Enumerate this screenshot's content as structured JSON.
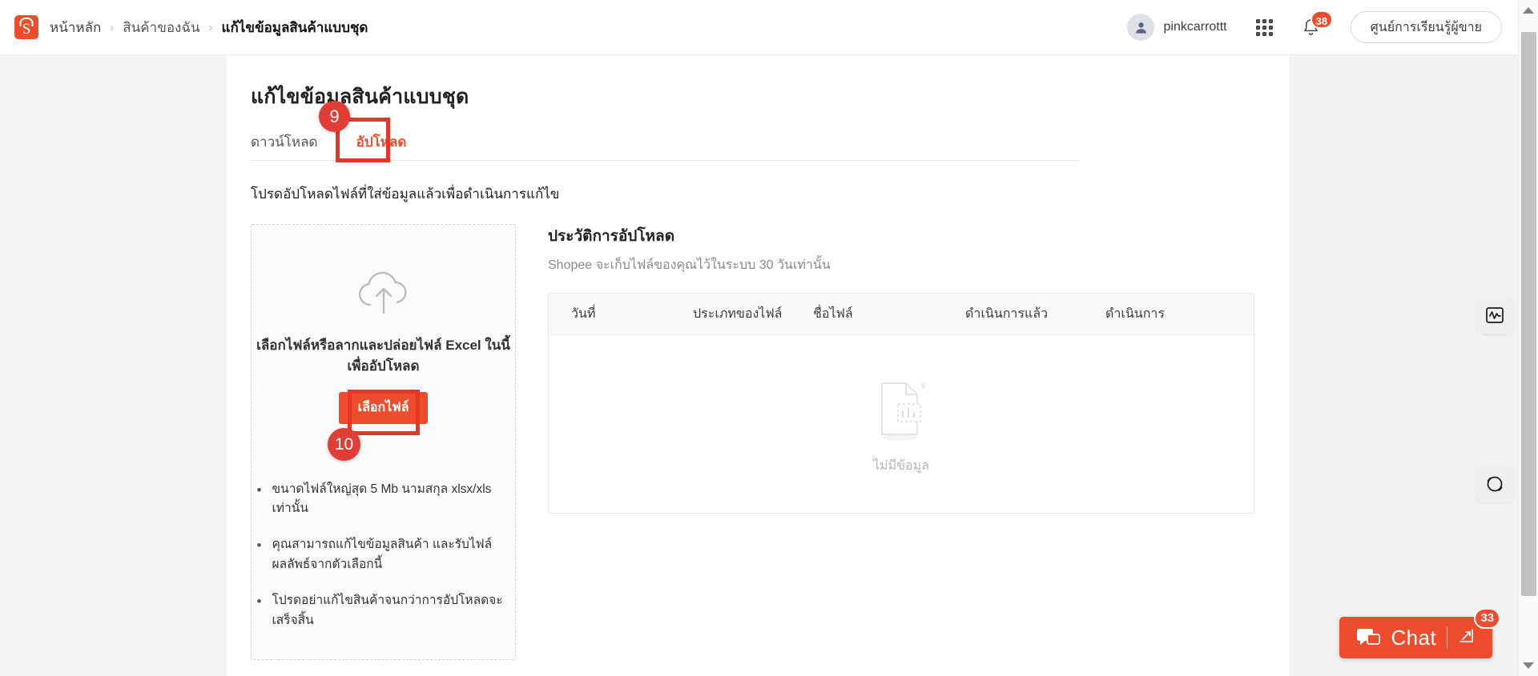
{
  "header": {
    "logo_alt": "shopee-logo",
    "breadcrumb": [
      {
        "label": "หน้าหลัก",
        "current": false
      },
      {
        "label": "สินค้าของฉัน",
        "current": false
      },
      {
        "label": "แก้ไขข้อมูลสินค้าแบบชุด",
        "current": true
      }
    ],
    "separator": "›",
    "user_name": "pinkcarrottt",
    "apps_icon": "grid-apps-icon",
    "notification_icon": "bell-icon",
    "notification_count": "38",
    "learning_center_label": "ศูนย์การเรียนรู้ผู้ขาย"
  },
  "main": {
    "page_title": "แก้ไขข้อมูลสินค้าแบบชุด",
    "tabs": [
      {
        "label": "ดาวน์โหลด",
        "active": false
      },
      {
        "label": "อัปโหลด",
        "active": true
      }
    ],
    "hint": "โปรดอัปโหลดไฟล์ที่ใส่ข้อมูลแล้วเพื่อดำเนินการแก้ไข"
  },
  "dropzone": {
    "icon": "cloud-upload-icon",
    "instruction": "เลือกไฟล์หรือลากและปล่อยไฟล์ Excel ในนี้เพื่ออัปโหลด",
    "choose_file_label": "เลือกไฟล์",
    "notes": [
      "ขนาดไฟล์ใหญ่สุด 5 Mb นามสกุล xlsx/xls เท่านั้น",
      "คุณสามารถแก้ไขข้อมูลสินค้า และรับไฟล์ผลลัพธ์จากตัวเลือกนี้",
      "โปรดอย่าแก้ไขสินค้าจนกว่าการอัปโหลดจะเสร็จสิ้น"
    ]
  },
  "history": {
    "title": "ประวัติการอัปโหลด",
    "subtitle": "Shopee จะเก็บไฟล์ของคุณไว้ในระบบ 30 วันเท่านั้น",
    "columns": [
      "วันที่",
      "ประเภทของไฟล์",
      "ชื่อไฟล์",
      "ดำเนินการแล้ว",
      "ดำเนินการ"
    ],
    "rows": [],
    "empty_text": "ไม่มีข้อมูล",
    "empty_icon": "empty-document-icon"
  },
  "side_widgets": [
    {
      "icon": "activity-monitor-icon",
      "name": "performance-widget"
    },
    {
      "icon": "headset-support-icon",
      "name": "support-widget"
    }
  ],
  "chat": {
    "label": "Chat",
    "badge": "33",
    "bubble_icon": "chat-bubble-icon",
    "expand_icon": "expand-arrow-icon"
  },
  "annotations": [
    {
      "id": "9",
      "target": "upload-tab"
    },
    {
      "id": "10",
      "target": "choose-file-button"
    }
  ],
  "colors": {
    "brand": "#ee4d2d",
    "annotation": "#e23c36",
    "page_bg": "#f5f5f5",
    "surface": "#ffffff"
  }
}
